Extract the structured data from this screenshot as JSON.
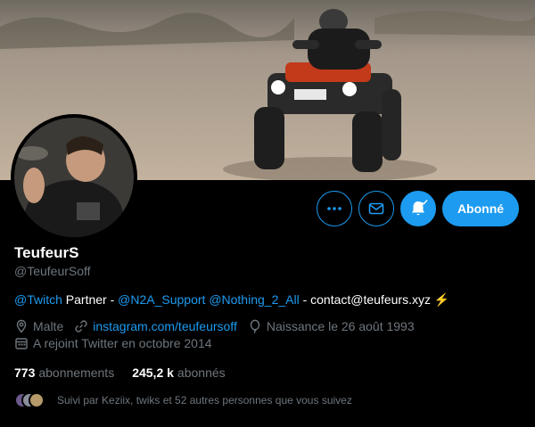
{
  "profile": {
    "name": "TeufeurS",
    "handle": "@TeufeurSoff",
    "bio": {
      "mention_twitch": "@Twitch",
      "partner_text": " Partner - ",
      "mention_n2a": "@N2A_Support",
      "space": " ",
      "mention_nothing": "@Nothing_2_All",
      "contact_text": " - contact@teufeurs.xyz ",
      "emoji": "⚡"
    },
    "location": "Malte",
    "website": "instagram.com/teufeursoff",
    "birthday": "Naissance le 26 août 1993",
    "joined": "A rejoint Twitter en octobre 2014"
  },
  "stats": {
    "following_count": "773",
    "following_label": "abonnements",
    "followers_count": "245,2 k",
    "followers_label": "abonnés"
  },
  "followed_by": "Suivi par Keziix, twiks et 52 autres personnes que vous suivez",
  "actions": {
    "more_icon": "more-icon",
    "message_icon": "envelope-icon",
    "notify_icon": "bell-icon",
    "follow_label": "Abonné"
  },
  "colors": {
    "accent": "#1d9bf0",
    "background": "#000000",
    "muted": "#6e767d",
    "text": "#ffffff"
  }
}
